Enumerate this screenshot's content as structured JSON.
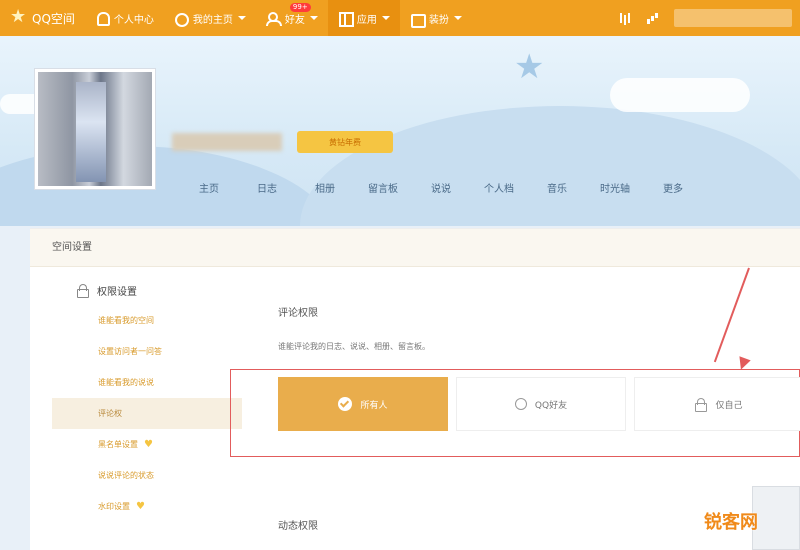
{
  "topbar": {
    "logo_text": "QQ空间",
    "items": [
      {
        "label": "个人中心"
      },
      {
        "label": "我的主页"
      },
      {
        "label": "好友",
        "badge": "99+"
      },
      {
        "label": "应用"
      },
      {
        "label": "装扮"
      }
    ]
  },
  "profile": {
    "vip_text": "黄钻年费"
  },
  "nav": [
    "主页",
    "日志",
    "相册",
    "留言板",
    "说说",
    "个人档",
    "音乐",
    "时光轴",
    "更多"
  ],
  "panel": {
    "header": "空间设置",
    "sidebar_title": "权限设置",
    "sidebar_items": [
      {
        "label": "谁能看我的空间",
        "heart": false
      },
      {
        "label": "设置访问者一问答",
        "heart": false
      },
      {
        "label": "谁能看我的说说",
        "heart": false
      },
      {
        "label": "评论权",
        "heart": false,
        "active": true
      },
      {
        "label": "黑名单设置",
        "heart": true
      },
      {
        "label": "说说评论的状态",
        "heart": false
      },
      {
        "label": "水印设置",
        "heart": true
      }
    ],
    "comment_section": {
      "title": "评论权限",
      "desc": "谁能评论我的日志、说说、相册、留言板。",
      "options": [
        {
          "label": "所有人",
          "selected": true
        },
        {
          "label": "QQ好友",
          "selected": false
        },
        {
          "label": "仅自己",
          "selected": false
        }
      ]
    },
    "section2_title": "动态权限"
  },
  "watermark": "锐客网",
  "colors": {
    "accent": "#f0a020",
    "selected": "#e9ad4c",
    "highlight": "#e25c5c"
  }
}
